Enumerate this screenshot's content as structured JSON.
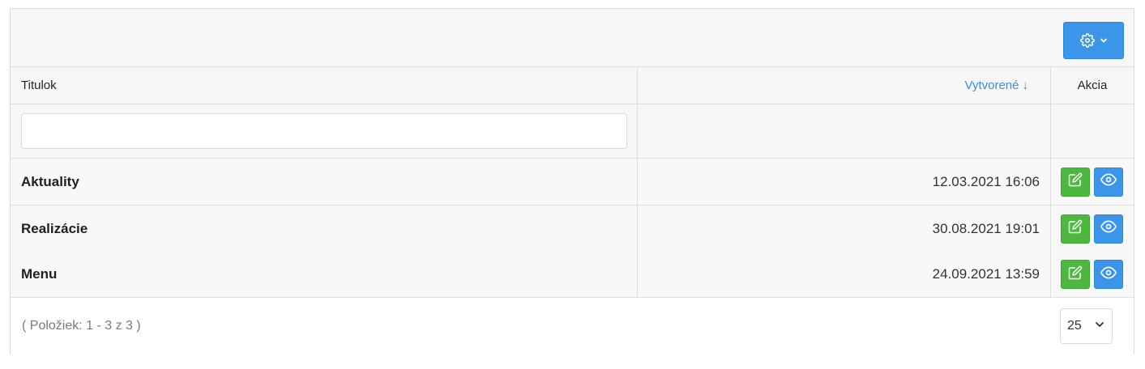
{
  "toolbar": {
    "settings_icon": "gear-icon",
    "dropdown_icon": "chevron-down-icon"
  },
  "table": {
    "columns": {
      "title": "Titulok",
      "created": "Vytvorené",
      "created_sort": "↓",
      "actions": "Akcia"
    },
    "filter": {
      "title_value": "",
      "title_placeholder": ""
    },
    "rows": [
      {
        "title": "Aktuality",
        "created": "12.03.2021 16:06"
      },
      {
        "title": "Realizácie",
        "created": "30.08.2021 19:01"
      },
      {
        "title": "Menu",
        "created": "24.09.2021 13:59"
      }
    ],
    "row_actions": {
      "edit_icon": "edit-icon",
      "view_icon": "eye-icon"
    }
  },
  "footer": {
    "count_text": "( Položiek: 1 - 3 z 3 )",
    "page_size": "25"
  },
  "colors": {
    "primary": "#3b95e9",
    "success": "#4cb83f",
    "link": "#3b8ee0"
  }
}
